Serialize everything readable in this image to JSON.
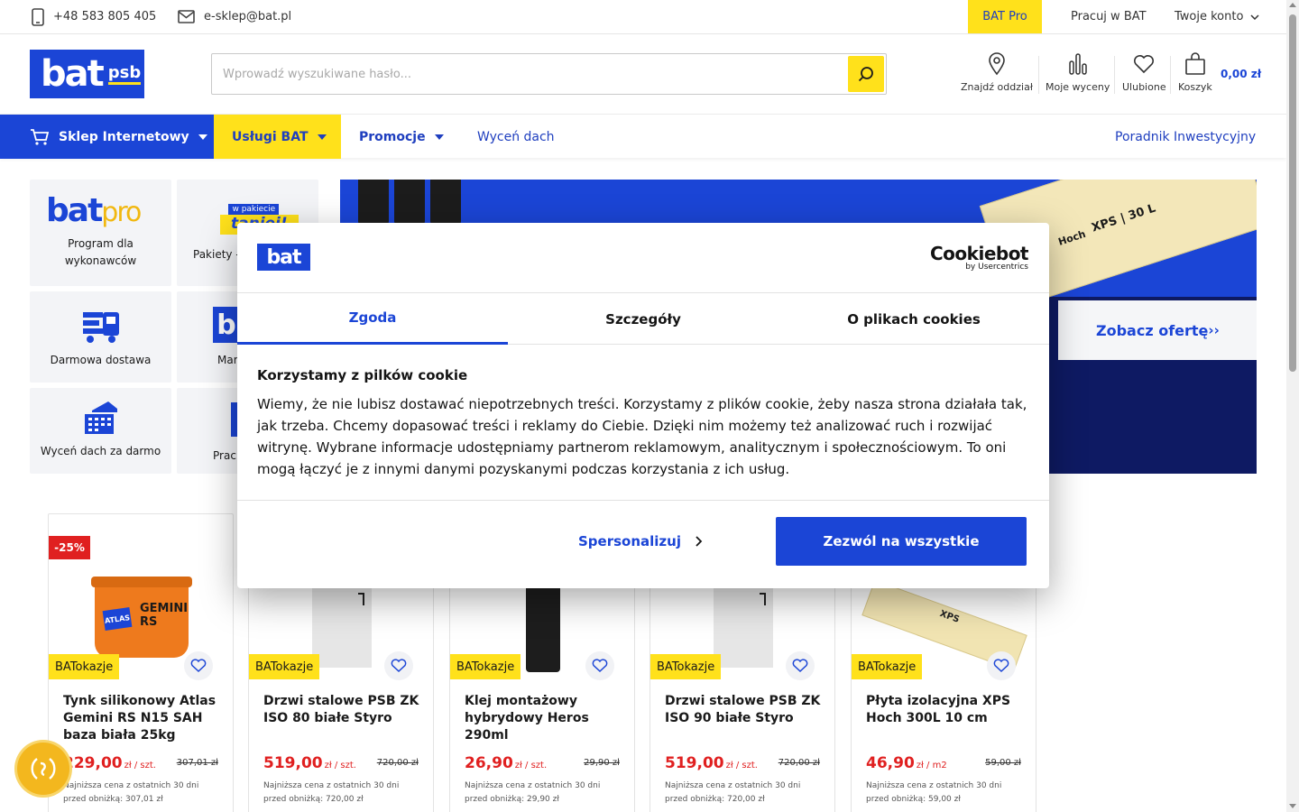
{
  "topbar": {
    "phone": "+48 583 805 405",
    "email": "e-sklep@bat.pl",
    "pro_label": "BAT Pro",
    "jobs_label": "Pracuj w BAT",
    "account_label": "Twoje konto"
  },
  "header": {
    "logo_text": "bat",
    "logo_sub": "psb",
    "search_placeholder": "Wprowadź wyszukiwane hasło...",
    "icons": [
      {
        "label": "Znajdź oddział",
        "icon": "map-pin-icon"
      },
      {
        "label": "Moje wyceny",
        "icon": "bar-chart-icon"
      },
      {
        "label": "Ulubione",
        "icon": "heart-icon"
      },
      {
        "label": "Koszyk",
        "icon": "bag-icon"
      }
    ],
    "cart_total": "0,00 zł"
  },
  "nav": {
    "shop": "Sklep Internetowy",
    "services": "Usługi BAT",
    "promotions": "Promocje",
    "roof": "Wyceń dach",
    "guide": "Poradnik Inwestycyjny"
  },
  "tiles": [
    {
      "label": "Program dla wykonawców",
      "logo_main": "bat",
      "logo_sub": "pro"
    },
    {
      "label": "Pakiety -",
      "sticker_top": "w pakiecie",
      "sticker_main": "taniej!"
    },
    {
      "label": "Darmowa dostawa"
    },
    {
      "label": "Mar"
    },
    {
      "label": "Wyceń dach za darmo"
    },
    {
      "label": "Prac"
    }
  ],
  "banner": {
    "cta": "Zobacz ofertę",
    "cta_arrows": "››",
    "product_text": "XPS | 30 L",
    "brand": "Hoch"
  },
  "cookie": {
    "logo": "bat",
    "brand_main": "Cookiebot",
    "brand_sub": "by Usercentrics",
    "tabs": [
      "Zgoda",
      "Szczegóły",
      "O plikach cookies"
    ],
    "title": "Korzystamy z pilków cookie",
    "text": "Wiemy, że nie lubisz dostawać niepotrzebnych treści. Korzystamy z plików cookie, żeby nasza strona działała tak, jak trzeba. Chcemy dopasować  treści i reklamy do Ciebie. Dzięki nim możemy też analizować ruch i rozwijać witrynę. Wybrane informacje udostępniamy partnerom reklamowym, analitycznym i społecznościowym. To oni  mogą łączyć je z innymi danymi pozyskanymi podczas korzystania z ich usług.",
    "personalize": "Spersonalizuj",
    "allow_all": "Zezwól na wszystkie"
  },
  "products": [
    {
      "discount": "-25%",
      "badge": "BATokazje",
      "title": "Tynk silikonowy Atlas Gemini RS N15 SAH baza biała 25kg",
      "price": "229,00",
      "unit": "zł / szt.",
      "old_price": "307,01 zł",
      "lowest_1": "Najniższa cena z ostatnich 30 dni",
      "lowest_2": "przed obniżką: 307,01 zł",
      "image_text": "GEMINI RS",
      "brand": "ATLAS"
    },
    {
      "discount": "",
      "badge": "BATokazje",
      "title": "Drzwi stalowe PSB ZK ISO 80 białe Styro",
      "price": "519,00",
      "unit": "zł / szt.",
      "old_price": "720,00 zł",
      "lowest_1": "Najniższa cena z ostatnich 30 dni",
      "lowest_2": "przed obniżką: 720,00 zł"
    },
    {
      "discount": "",
      "badge": "BATokazje",
      "title": "Klej montażowy hybrydowy Heros 290ml",
      "price": "26,90",
      "unit": "zł / szt.",
      "old_price": "29,90 zł",
      "lowest_1": "Najniższa cena z ostatnich 30 dni",
      "lowest_2": "przed obniżką: 29,90 zł"
    },
    {
      "discount": "",
      "badge": "BATokazje",
      "title": "Drzwi stalowe PSB ZK ISO 90 białe Styro",
      "price": "519,00",
      "unit": "zł / szt.",
      "old_price": "720,00 zł",
      "lowest_1": "Najniższa cena z ostatnich 30 dni",
      "lowest_2": "przed obniżką: 720,00 zł"
    },
    {
      "discount": "",
      "badge": "BATokazje",
      "title": "Płyta izolacyjna XPS Hoch 300L 10 cm",
      "price": "46,90",
      "unit": "zł / m2",
      "old_price": "59,00 zł",
      "lowest_1": "Najniższa cena z ostatnich 30 dni",
      "lowest_2": "przed obniżką: 59,00 zł",
      "image_text": "XPS"
    }
  ],
  "colors": {
    "brand_blue": "#1b45d6",
    "brand_yellow": "#ffe11b",
    "price_red": "#e02020",
    "dark_navy": "#0e1a63"
  }
}
